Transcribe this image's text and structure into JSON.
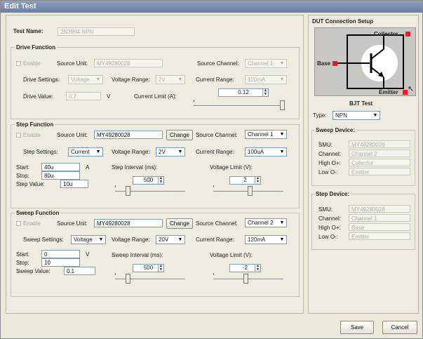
{
  "window": {
    "title": "Edit Test"
  },
  "test": {
    "name_label": "Test Name:",
    "name_value": "2N3904 NPN"
  },
  "drive": {
    "title": "Drive Function",
    "enable_label": "Enable",
    "source_unit_label": "Source Unit:",
    "source_unit_value": "MY49280028",
    "source_channel_label": "Source Channel:",
    "source_channel_value": "Channel 1",
    "settings_label": "Drive Settings:",
    "settings_value": "Voltage",
    "voltage_range_label": "Voltage Range:",
    "voltage_range_value": "2V",
    "current_range_label": "Current Range:",
    "current_range_value": "120mA",
    "drive_value_label": "Drive Value:",
    "drive_value": "0.7",
    "drive_unit": "V",
    "current_limit_label": "Current Limit (A):",
    "current_limit_value": "0.12"
  },
  "step": {
    "title": "Step Function",
    "enable_label": "Enable",
    "source_unit_label": "Source Unit:",
    "source_unit_value": "MY49280028",
    "change_label": "Change",
    "source_channel_label": "Source Channel:",
    "source_channel_value": "Channel 1",
    "settings_label": "Step Settings:",
    "settings_value": "Current",
    "voltage_range_label": "Voltage Range:",
    "voltage_range_value": "2V",
    "current_range_label": "Current Range:",
    "current_range_value": "100uA",
    "start_label": "Start:",
    "start_value": "40u",
    "unit": "A",
    "stop_label": "Stop:",
    "stop_value": "80u",
    "step_value_label": "Step Value:",
    "step_value": "10u",
    "interval_label": "Step Interval (ms):",
    "interval_value": "500",
    "voltage_limit_label": "Voltage Limit (V):",
    "voltage_limit_value": "2"
  },
  "sweep": {
    "title": "Sweep Function",
    "enable_label": "Enable",
    "source_unit_label": "Source Unit:",
    "source_unit_value": "MY49280028",
    "change_label": "Change",
    "source_channel_label": "Source Channel:",
    "source_channel_value": "Channel 2",
    "settings_label": "Sweep Settings:",
    "settings_value": "Voltage",
    "voltage_range_label": "Voltage Range:",
    "voltage_range_value": "20V",
    "current_range_label": "Current Range:",
    "current_range_value": "120mA",
    "start_label": "Start:",
    "start_value": "0",
    "unit": "V",
    "stop_label": "Stop:",
    "stop_value": "10",
    "sweep_value_label": "Sweep Value:",
    "sweep_value": "0.1",
    "interval_label": "Sweep Interval (ms):",
    "interval_value": "500",
    "voltage_limit_label": "Voltage Limit (V):",
    "voltage_limit_value": "-2"
  },
  "dut": {
    "title": "DUT Connection Setup",
    "collector_label": "Collector",
    "base_label": "Base",
    "emitter_label": "Emitter",
    "bjt_title": "BJT Test",
    "type_label": "Type:",
    "type_value": "NPN",
    "terminal_color": "#e0202c"
  },
  "sweep_device": {
    "title": "Sweep Device:",
    "smu_label": "SMU:",
    "smu_value": "MY49280028",
    "channel_label": "Channel:",
    "channel_value": "Channel 2",
    "high_label": "High O+:",
    "high_value": "Collector",
    "low_label": "Low O-:",
    "low_value": "Emitter"
  },
  "step_device": {
    "title": "Step Device:",
    "smu_label": "SMU:",
    "smu_value": "MY49280028",
    "channel_label": "Channel:",
    "channel_value": "Channel 1",
    "high_label": "High O+:",
    "high_value": "Base",
    "low_label": "Low O-:",
    "low_value": "Emitter"
  },
  "actions": {
    "save_label": "Save",
    "cancel_label": "Cancel"
  }
}
